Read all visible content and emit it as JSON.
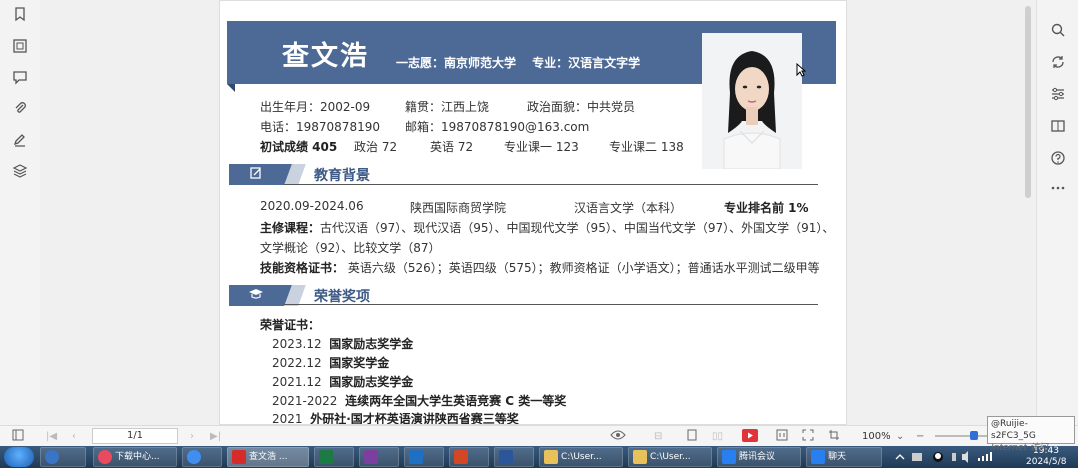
{
  "left_toolbar": [
    "bookmark-icon",
    "thumbnail-icon",
    "comment-icon",
    "attachment-icon",
    "sign-icon",
    "layers-icon"
  ],
  "right_toolbar": [
    "search-icon",
    "rotate-icon",
    "settings-icon",
    "compare-icon",
    "help-icon",
    "more-icon"
  ],
  "resume": {
    "name": "查文浩",
    "aspiration": "一志愿：南京师范大学　 专业：汉语言文字学",
    "info": {
      "birth": "出生年月：2002-09",
      "native": "籍贯：江西上饶",
      "political": "政治面貌：中共党员",
      "phone": "电话：19870878190",
      "email": "邮箱：19870878190@163.com",
      "score_label": "初试成绩 405",
      "politics": "政治 72",
      "english": "英语 72",
      "course1": "专业课一 123",
      "course2": "专业课二 138"
    },
    "education": {
      "title": "教育背景",
      "period": "2020.09-2024.06",
      "school": "陕西国际商贸学院",
      "major": "汉语言文学（本科）",
      "rank": "专业排名前 1%",
      "courses_label": "主修课程：",
      "courses_line1": "古代汉语（97）、现代汉语（95）、中国现代文学（95）、中国当代文学（97）、外国文学（91）、",
      "courses_line2": "文学概论（92）、比较文学（87）",
      "skills_label": "技能资格证书：",
      "skills": " 英语六级（526）；英语四级（575）；教师资格证（小学语文）；普通话水平测试二级甲等"
    },
    "honors": {
      "title": "荣誉奖项",
      "cert_label": "荣誉证书：",
      "items": [
        {
          "date": "2023.12",
          "name": "国家励志奖学金"
        },
        {
          "date": "2022.12",
          "name": "国家奖学金"
        },
        {
          "date": "2021.12",
          "name": "国家励志奖学金"
        },
        {
          "date": "2021-2022",
          "name": "连续两年全国大学生英语竞赛 C 类一等奖"
        },
        {
          "date": "2021",
          "name": "外研社·国才杯英语演讲陕西省赛三等奖"
        }
      ]
    }
  },
  "status_bar": {
    "page": "1/1",
    "zoom": "100%"
  },
  "taskbar": {
    "items": [
      {
        "label": "下载中心...",
        "color": "#e84a5f"
      },
      {
        "label": "",
        "color": "#3f8ef0"
      },
      {
        "label": "查文浩 ...",
        "color": "#d62b2b"
      },
      {
        "label": "",
        "color": "#1e7a45"
      },
      {
        "label": "",
        "color": "#7b3fa0"
      },
      {
        "label": "",
        "color": "#1f6fc2"
      },
      {
        "label": "",
        "color": "#d24726"
      },
      {
        "label": "",
        "color": "#2b579a"
      },
      {
        "label": "C:\\User...",
        "color": "#e8c15a"
      },
      {
        "label": "C:\\User...",
        "color": "#e8c15a"
      },
      {
        "label": "腾讯会议",
        "color": "#2a7ff0"
      },
      {
        "label": "聊天",
        "color": "#2a7ff0"
      }
    ],
    "time": "19:43",
    "date": "2024/5/8"
  },
  "tooltip": {
    "line1": "@Ruijie-s2FC3_5G",
    "line2": "Internet 访问"
  },
  "colors": {
    "accent": "#4c6a95",
    "accent_dark": "#2f4a70"
  }
}
